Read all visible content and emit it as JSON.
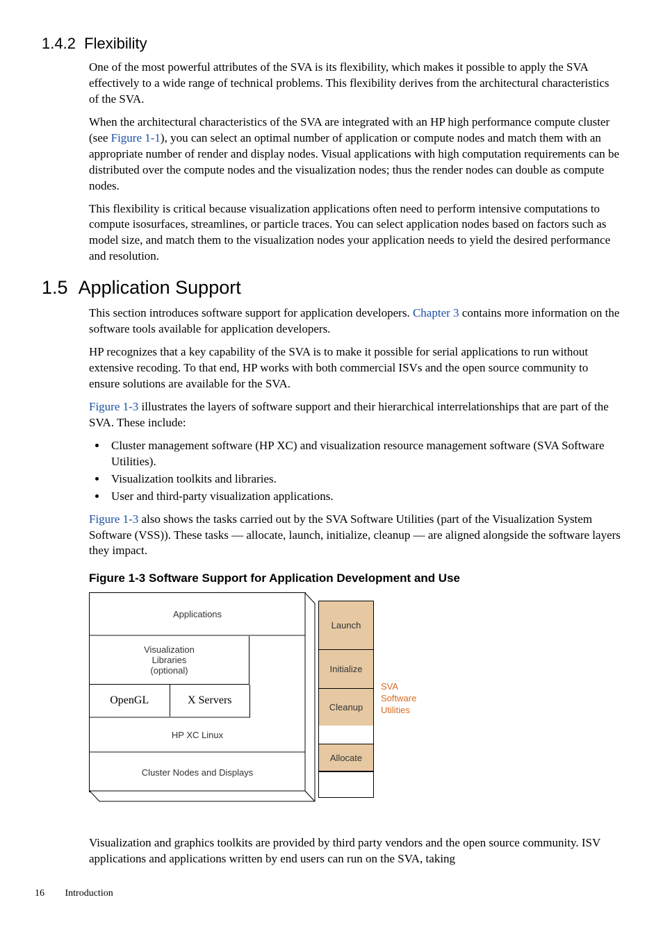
{
  "sec142": {
    "num": "1.4.2",
    "title": "Flexibility",
    "p1": "One of the most powerful attributes of the SVA is its flexibility, which makes it possible to apply the SVA effectively to a wide range of technical problems. This flexibility derives from the architectural characteristics of the SVA.",
    "p2a": "When the architectural characteristics of the SVA are integrated with an HP high performance compute cluster (see ",
    "p2link": "Figure 1-1",
    "p2b": "), you can select an optimal number of application or compute nodes and match them with an appropriate number of render and display nodes. Visual applications with high computation requirements can be distributed over the compute nodes and the visualization nodes; thus the render nodes can double as compute nodes.",
    "p3": "This flexibility is critical because visualization applications often need to perform intensive computations to compute isosurfaces, streamlines, or particle traces. You can select application nodes based on factors such as model size, and match them to the visualization nodes your application needs to yield the desired performance and resolution."
  },
  "sec15": {
    "num": "1.5",
    "title": "Application Support",
    "p1a": "This section introduces software support for application developers. ",
    "p1link": "Chapter 3",
    "p1b": " contains more information on the software tools available for application developers.",
    "p2": "HP recognizes that a key capability of the SVA is to make it possible for serial applications to run without extensive recoding. To that end, HP works with both commercial ISVs and the open source community to ensure solutions are available for the SVA.",
    "p3link": "Figure 1-3",
    "p3b": " illustrates the layers of software support and their hierarchical interrelationships that are part of the SVA. These include:",
    "bullets": [
      "Cluster management software (HP XC) and visualization resource management software (SVA Software Utilities).",
      "Visualization toolkits and libraries.",
      "User and third-party visualization applications."
    ],
    "p4link": "Figure 1-3",
    "p4b": " also shows the tasks carried out by the SVA Software Utilities (part of the Visualization System Software (VSS)). These tasks — allocate, launch, initialize, cleanup — are aligned alongside the software layers they impact.",
    "p5": "Visualization and graphics toolkits are provided by third party vendors and the open source community. ISV applications and applications written by end users can run on the SVA, taking"
  },
  "figure": {
    "caption_prefix": "Figure  1-3 ",
    "caption": "Software Support for Application Development and Use",
    "stack": {
      "apps": "Applications",
      "vis": "Visualization\nLibraries\n(optional)",
      "opengl": "OpenGL",
      "xservers": "X Servers",
      "xc": "HP XC Linux",
      "nodes": "Cluster Nodes and Displays"
    },
    "tasks": {
      "launch": "Launch",
      "init": "Initialize",
      "clean": "Cleanup",
      "alloc": "Allocate"
    },
    "side_label": "SVA\nSoftware\nUtilities"
  },
  "footer": {
    "page": "16",
    "section": "Introduction"
  }
}
